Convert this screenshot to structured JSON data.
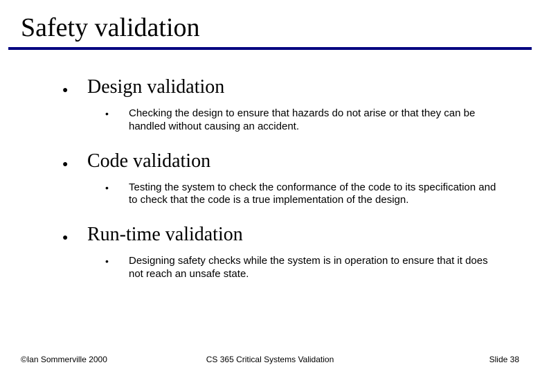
{
  "title": "Safety validation",
  "items": [
    {
      "label": "Design validation",
      "sub": "Checking the design to ensure that hazards do not arise or that they can be handled without causing an accident."
    },
    {
      "label": "Code validation",
      "sub": "Testing the system to check the conformance of the code to its specification and to check that the code is a true implementation of the design."
    },
    {
      "label": "Run-time validation",
      "sub": "Designing safety checks while the system is in operation to ensure that it does not reach an unsafe state."
    }
  ],
  "footer": {
    "left": "©Ian Sommerville 2000",
    "center": "CS 365  Critical Systems Validation",
    "right": "Slide 38"
  }
}
